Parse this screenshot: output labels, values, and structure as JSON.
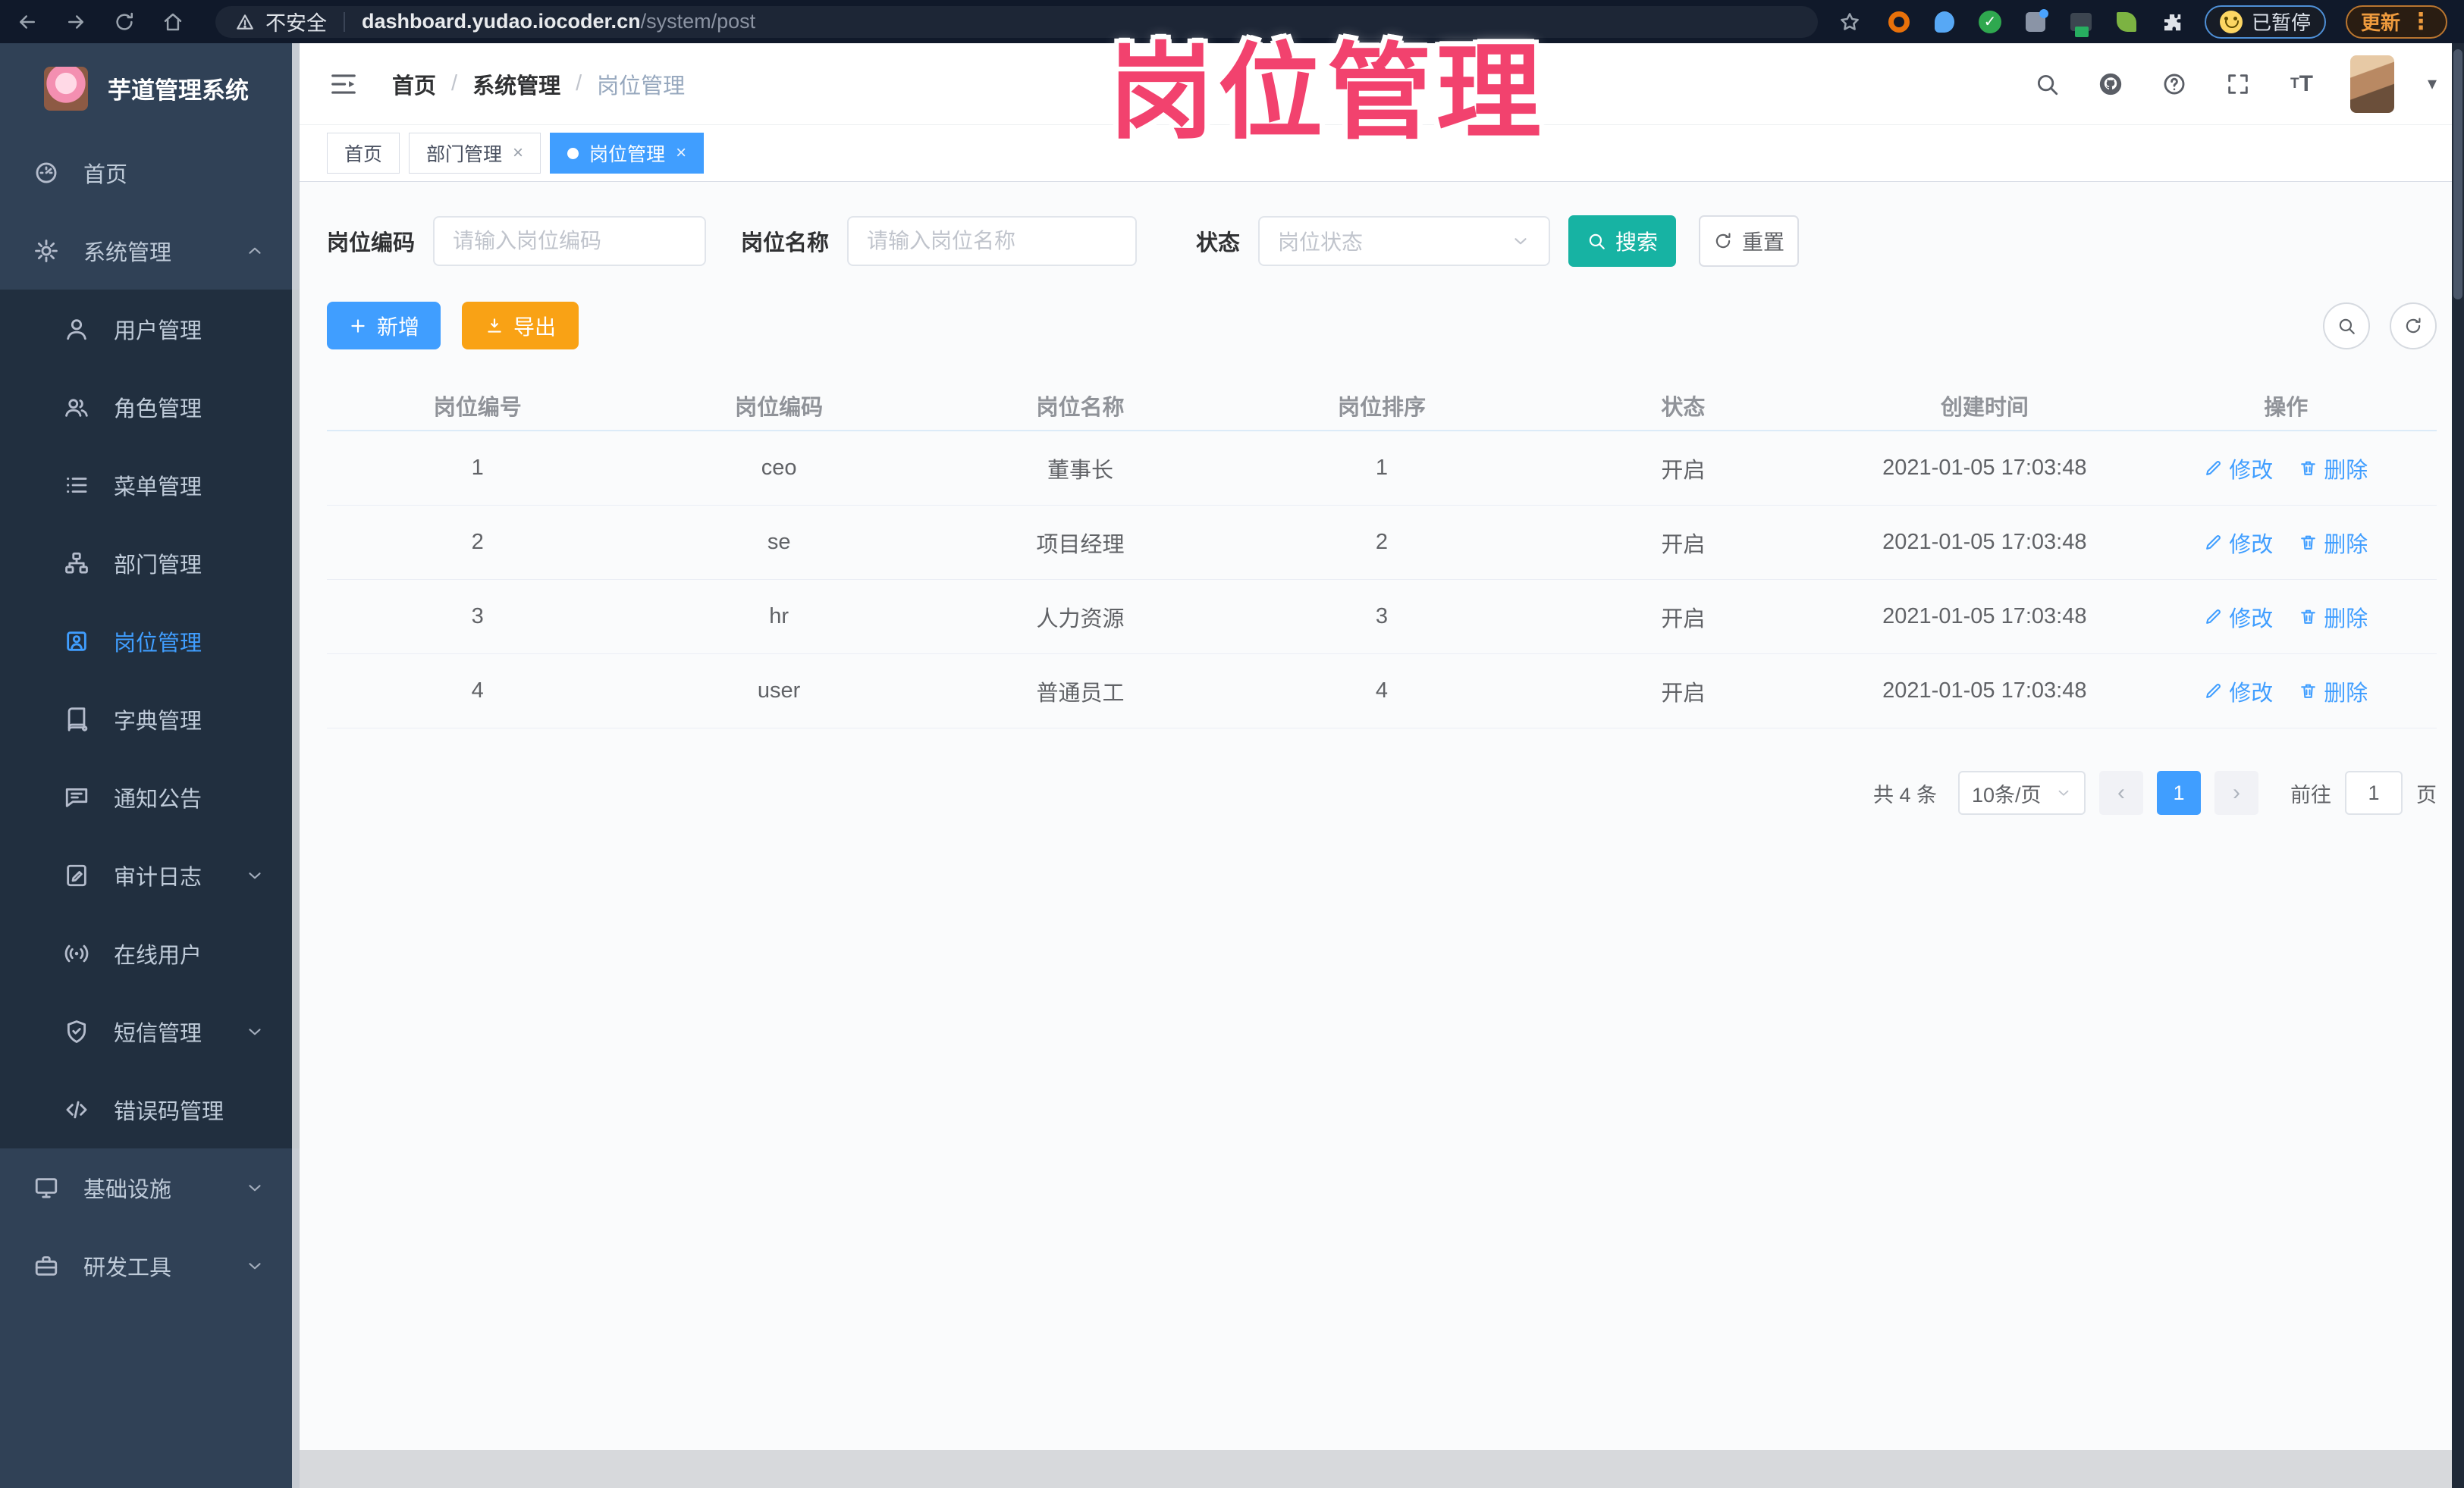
{
  "colors": {
    "accent": "#409eff",
    "teal": "#17b3a3",
    "amber": "#f9a215",
    "watermark_pink": "#f2426e",
    "sidebar_bg": "#304156",
    "submenu_bg": "#212f3f",
    "sidebar_text": "#bfcbd9",
    "browser_bar_bg": "#10192a",
    "content_bg": "#fafbfc",
    "table_text": "#606266",
    "header_text": "#909399"
  },
  "browser": {
    "security_label": "不安全",
    "url_host": "dashboard.yudao.iocoder.cn",
    "url_path": "/system/post",
    "paused_label": "已暂停",
    "update_label": "更新",
    "kebab": "⋮"
  },
  "watermark": {
    "text": "岗位管理"
  },
  "sidebar": {
    "logo_title": "芋道管理系统",
    "items": [
      {
        "id": "home",
        "label": "首页",
        "icon": "dashboard-icon",
        "level": "top"
      },
      {
        "id": "system",
        "label": "系统管理",
        "icon": "gear-icon",
        "level": "top",
        "arrow": "up"
      },
      {
        "id": "user",
        "label": "用户管理",
        "icon": "user-icon",
        "level": "sub"
      },
      {
        "id": "role",
        "label": "角色管理",
        "icon": "role-icon",
        "level": "sub"
      },
      {
        "id": "menu",
        "label": "菜单管理",
        "icon": "menu-list-icon",
        "level": "sub"
      },
      {
        "id": "dept",
        "label": "部门管理",
        "icon": "org-tree-icon",
        "level": "sub"
      },
      {
        "id": "post",
        "label": "岗位管理",
        "icon": "post-badge-icon",
        "level": "sub",
        "active": true
      },
      {
        "id": "dict",
        "label": "字典管理",
        "icon": "dictionary-icon",
        "level": "sub"
      },
      {
        "id": "notice",
        "label": "通知公告",
        "icon": "announcement-icon",
        "level": "sub"
      },
      {
        "id": "audit",
        "label": "审计日志",
        "icon": "audit-log-icon",
        "level": "sub",
        "arrow": "down"
      },
      {
        "id": "online",
        "label": "在线用户",
        "icon": "online-signal-icon",
        "level": "sub"
      },
      {
        "id": "sms",
        "label": "短信管理",
        "icon": "shield-icon",
        "level": "sub",
        "arrow": "down"
      },
      {
        "id": "errcode",
        "label": "错误码管理",
        "icon": "code-icon",
        "level": "sub"
      },
      {
        "id": "infra",
        "label": "基础设施",
        "icon": "monitor-icon",
        "level": "top",
        "arrow": "down"
      },
      {
        "id": "devtools",
        "label": "研发工具",
        "icon": "toolbox-icon",
        "level": "top",
        "arrow": "down"
      }
    ]
  },
  "breadcrumb": {
    "separator": "/",
    "items": [
      "首页",
      "系统管理",
      "岗位管理"
    ]
  },
  "tabs": [
    {
      "id": "home",
      "label": "首页",
      "closable": false,
      "active": false
    },
    {
      "id": "dept",
      "label": "部门管理",
      "closable": true,
      "active": false
    },
    {
      "id": "post",
      "label": "岗位管理",
      "closable": true,
      "active": true
    }
  ],
  "filters": {
    "code_label": "岗位编码",
    "code_placeholder": "请输入岗位编码",
    "name_label": "岗位名称",
    "name_placeholder": "请输入岗位名称",
    "status_label": "状态",
    "status_placeholder": "岗位状态",
    "search_label": "搜索",
    "reset_label": "重置"
  },
  "toolbar": {
    "add_label": "新增",
    "export_label": "导出"
  },
  "table": {
    "columns": [
      "岗位编号",
      "岗位编码",
      "岗位名称",
      "岗位排序",
      "状态",
      "创建时间",
      "操作"
    ],
    "edit_label": "修改",
    "delete_label": "删除",
    "rows": [
      {
        "id": "1",
        "code": "ceo",
        "name": "董事长",
        "sort": "1",
        "status": "开启",
        "created": "2021-01-05 17:03:48"
      },
      {
        "id": "2",
        "code": "se",
        "name": "项目经理",
        "sort": "2",
        "status": "开启",
        "created": "2021-01-05 17:03:48"
      },
      {
        "id": "3",
        "code": "hr",
        "name": "人力资源",
        "sort": "3",
        "status": "开启",
        "created": "2021-01-05 17:03:48"
      },
      {
        "id": "4",
        "code": "user",
        "name": "普通员工",
        "sort": "4",
        "status": "开启",
        "created": "2021-01-05 17:03:48"
      }
    ]
  },
  "pagination": {
    "total_text": "共 4 条",
    "page_size": "10条/页",
    "current_page": "1",
    "goto_label": "前往",
    "goto_value": "1",
    "unit_label": "页"
  }
}
